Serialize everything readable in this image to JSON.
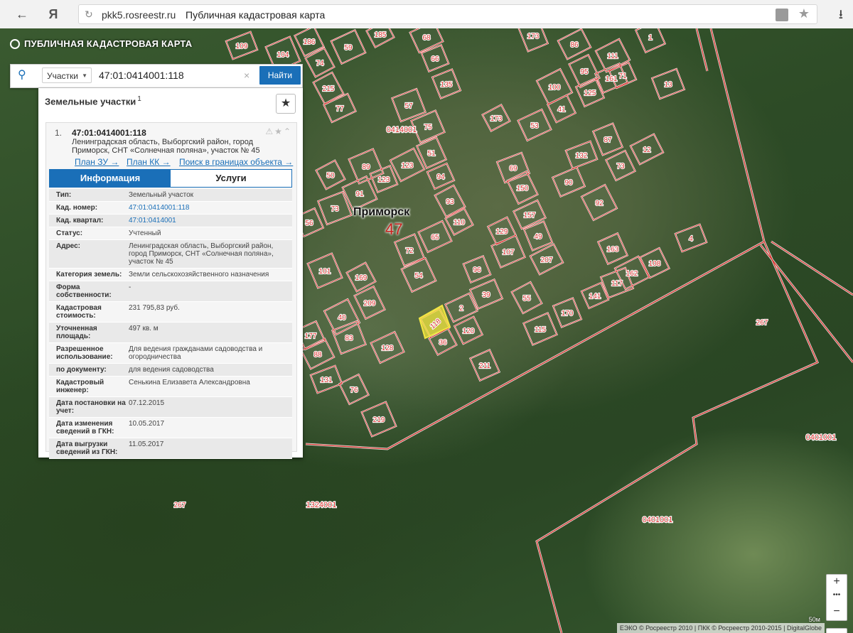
{
  "browser": {
    "back_icon": "back-arrow-icon",
    "yandex_logo": "Я",
    "host": "pkk5.rosreestr.ru",
    "page_title": "Публичная кадастровая карта"
  },
  "app": {
    "title": "ПУБЛИЧНАЯ КАДАСТРОВАЯ КАРТА"
  },
  "search": {
    "category": "Участки",
    "value": "47:01:0414001:118",
    "button": "Найти"
  },
  "results": {
    "header": "Земельные участки",
    "count": "1",
    "item": {
      "index": "1.",
      "cad_number": "47:01:0414001:118",
      "address": "Ленинградская область, Выборгский район, город Приморск, СНТ «Солнечная поляна», участок № 45",
      "links": [
        "План ЗУ →",
        "План КК →",
        "Поиск в границах объекта →"
      ],
      "tabs": [
        "Информация",
        "Услуги"
      ],
      "properties": [
        {
          "key": "Тип:",
          "value": "Земельный участок"
        },
        {
          "key": "Кад. номер:",
          "value": "47:01:0414001:118"
        },
        {
          "key": "Кад. квартал:",
          "value": "47:01:0414001"
        },
        {
          "key": "Статус:",
          "value": "Учтенный"
        },
        {
          "key": "Адрес:",
          "value": "Ленинградская область, Выборгский район, город Приморск, СНТ «Солнечная поляна», участок № 45"
        },
        {
          "key": "Категория земель:",
          "value": "Земли сельскохозяйственного назначения"
        },
        {
          "key": "Форма собственности:",
          "value": "-"
        },
        {
          "key": "Кадастровая стоимость:",
          "value": "231 795,83 руб."
        },
        {
          "key": "Уточненная площадь:",
          "value": "497 кв. м"
        },
        {
          "key": "Разрешенное использование:",
          "value": "Для ведения гражданами садоводства и огородничества"
        },
        {
          "key": "по документу:",
          "value": "для ведения садоводства"
        },
        {
          "key": "Кадастровый инженер:",
          "value": "Сенькина Елизавета Александровна"
        },
        {
          "key": "Дата постановки на учет:",
          "value": "07.12.2015"
        },
        {
          "key": "Дата изменения сведений в ГКН:",
          "value": "10.05.2017"
        },
        {
          "key": "Дата выгрузки сведений из ГКН:",
          "value": "11.05.2017"
        }
      ]
    }
  },
  "map": {
    "city": "Приморск",
    "region": "47",
    "quarters": [
      "0414001",
      "1324001",
      "0401001",
      "0401001"
    ],
    "parcels": [
      "185",
      "68",
      "173",
      "86",
      "1",
      "109",
      "186",
      "104",
      "74",
      "59",
      "66",
      "111",
      "71",
      "13",
      "95",
      "161",
      "215",
      "77",
      "135",
      "100",
      "125",
      "57",
      "41",
      "75",
      "173",
      "53",
      "87",
      "12",
      "51",
      "132",
      "73",
      "89",
      "50",
      "91",
      "123",
      "123",
      "94",
      "69",
      "150",
      "90",
      "93",
      "157",
      "49",
      "92",
      "56",
      "73",
      "129",
      "107",
      "110",
      "65",
      "72",
      "207",
      "163",
      "4",
      "108",
      "101",
      "169",
      "54",
      "96",
      "162",
      "141",
      "117",
      "209",
      "39",
      "55",
      "2",
      "170",
      "40",
      "177",
      "83",
      "120",
      "115",
      "36",
      "128",
      "267",
      "88",
      "211",
      "131",
      "76",
      "219",
      "118",
      "267"
    ],
    "zoom_in": "+",
    "zoom_out": "−",
    "more": "•••",
    "scale": "50м",
    "copyright": "ЕЭКО © Росреестр 2010 | ПКК © Росреестр 2010-2015 | DigitalGlobe"
  }
}
